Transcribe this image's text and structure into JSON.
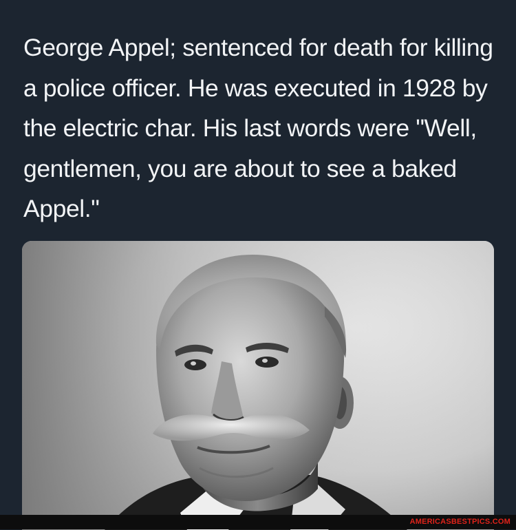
{
  "post": {
    "caption": "George Appel; sentenced for death for killing a police officer. He was executed in 1928 by the electric char. His last words were \"Well, gentlemen, you are about to see a baked Appel.\"",
    "photo_icon": "portrait-photo"
  },
  "watermark": {
    "text": "AMERICASBESTPICS.COM"
  },
  "colors": {
    "background": "#1c2530",
    "caption_text": "#f2f4f6",
    "watermark": "#e0231a"
  }
}
